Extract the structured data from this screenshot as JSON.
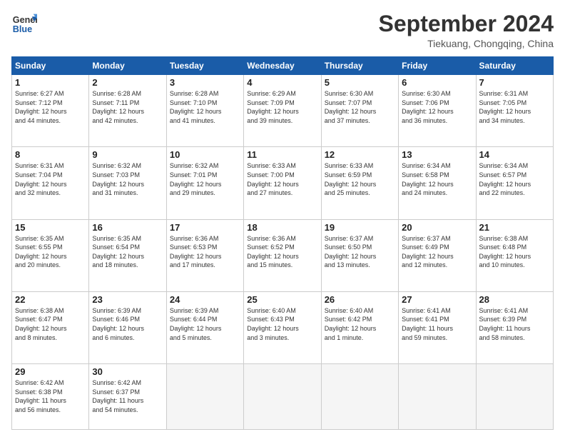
{
  "logo": {
    "line1": "General",
    "line2": "Blue"
  },
  "title": "September 2024",
  "location": "Tiekuang, Chongqing, China",
  "weekdays": [
    "Sunday",
    "Monday",
    "Tuesday",
    "Wednesday",
    "Thursday",
    "Friday",
    "Saturday"
  ],
  "weeks": [
    [
      {
        "day": "1",
        "info": "Sunrise: 6:27 AM\nSunset: 7:12 PM\nDaylight: 12 hours\nand 44 minutes."
      },
      {
        "day": "2",
        "info": "Sunrise: 6:28 AM\nSunset: 7:11 PM\nDaylight: 12 hours\nand 42 minutes."
      },
      {
        "day": "3",
        "info": "Sunrise: 6:28 AM\nSunset: 7:10 PM\nDaylight: 12 hours\nand 41 minutes."
      },
      {
        "day": "4",
        "info": "Sunrise: 6:29 AM\nSunset: 7:09 PM\nDaylight: 12 hours\nand 39 minutes."
      },
      {
        "day": "5",
        "info": "Sunrise: 6:30 AM\nSunset: 7:07 PM\nDaylight: 12 hours\nand 37 minutes."
      },
      {
        "day": "6",
        "info": "Sunrise: 6:30 AM\nSunset: 7:06 PM\nDaylight: 12 hours\nand 36 minutes."
      },
      {
        "day": "7",
        "info": "Sunrise: 6:31 AM\nSunset: 7:05 PM\nDaylight: 12 hours\nand 34 minutes."
      }
    ],
    [
      {
        "day": "8",
        "info": "Sunrise: 6:31 AM\nSunset: 7:04 PM\nDaylight: 12 hours\nand 32 minutes."
      },
      {
        "day": "9",
        "info": "Sunrise: 6:32 AM\nSunset: 7:03 PM\nDaylight: 12 hours\nand 31 minutes."
      },
      {
        "day": "10",
        "info": "Sunrise: 6:32 AM\nSunset: 7:01 PM\nDaylight: 12 hours\nand 29 minutes."
      },
      {
        "day": "11",
        "info": "Sunrise: 6:33 AM\nSunset: 7:00 PM\nDaylight: 12 hours\nand 27 minutes."
      },
      {
        "day": "12",
        "info": "Sunrise: 6:33 AM\nSunset: 6:59 PM\nDaylight: 12 hours\nand 25 minutes."
      },
      {
        "day": "13",
        "info": "Sunrise: 6:34 AM\nSunset: 6:58 PM\nDaylight: 12 hours\nand 24 minutes."
      },
      {
        "day": "14",
        "info": "Sunrise: 6:34 AM\nSunset: 6:57 PM\nDaylight: 12 hours\nand 22 minutes."
      }
    ],
    [
      {
        "day": "15",
        "info": "Sunrise: 6:35 AM\nSunset: 6:55 PM\nDaylight: 12 hours\nand 20 minutes."
      },
      {
        "day": "16",
        "info": "Sunrise: 6:35 AM\nSunset: 6:54 PM\nDaylight: 12 hours\nand 18 minutes."
      },
      {
        "day": "17",
        "info": "Sunrise: 6:36 AM\nSunset: 6:53 PM\nDaylight: 12 hours\nand 17 minutes."
      },
      {
        "day": "18",
        "info": "Sunrise: 6:36 AM\nSunset: 6:52 PM\nDaylight: 12 hours\nand 15 minutes."
      },
      {
        "day": "19",
        "info": "Sunrise: 6:37 AM\nSunset: 6:50 PM\nDaylight: 12 hours\nand 13 minutes."
      },
      {
        "day": "20",
        "info": "Sunrise: 6:37 AM\nSunset: 6:49 PM\nDaylight: 12 hours\nand 12 minutes."
      },
      {
        "day": "21",
        "info": "Sunrise: 6:38 AM\nSunset: 6:48 PM\nDaylight: 12 hours\nand 10 minutes."
      }
    ],
    [
      {
        "day": "22",
        "info": "Sunrise: 6:38 AM\nSunset: 6:47 PM\nDaylight: 12 hours\nand 8 minutes."
      },
      {
        "day": "23",
        "info": "Sunrise: 6:39 AM\nSunset: 6:46 PM\nDaylight: 12 hours\nand 6 minutes."
      },
      {
        "day": "24",
        "info": "Sunrise: 6:39 AM\nSunset: 6:44 PM\nDaylight: 12 hours\nand 5 minutes."
      },
      {
        "day": "25",
        "info": "Sunrise: 6:40 AM\nSunset: 6:43 PM\nDaylight: 12 hours\nand 3 minutes."
      },
      {
        "day": "26",
        "info": "Sunrise: 6:40 AM\nSunset: 6:42 PM\nDaylight: 12 hours\nand 1 minute."
      },
      {
        "day": "27",
        "info": "Sunrise: 6:41 AM\nSunset: 6:41 PM\nDaylight: 11 hours\nand 59 minutes."
      },
      {
        "day": "28",
        "info": "Sunrise: 6:41 AM\nSunset: 6:39 PM\nDaylight: 11 hours\nand 58 minutes."
      }
    ],
    [
      {
        "day": "29",
        "info": "Sunrise: 6:42 AM\nSunset: 6:38 PM\nDaylight: 11 hours\nand 56 minutes."
      },
      {
        "day": "30",
        "info": "Sunrise: 6:42 AM\nSunset: 6:37 PM\nDaylight: 11 hours\nand 54 minutes."
      },
      {
        "day": "",
        "info": ""
      },
      {
        "day": "",
        "info": ""
      },
      {
        "day": "",
        "info": ""
      },
      {
        "day": "",
        "info": ""
      },
      {
        "day": "",
        "info": ""
      }
    ]
  ]
}
